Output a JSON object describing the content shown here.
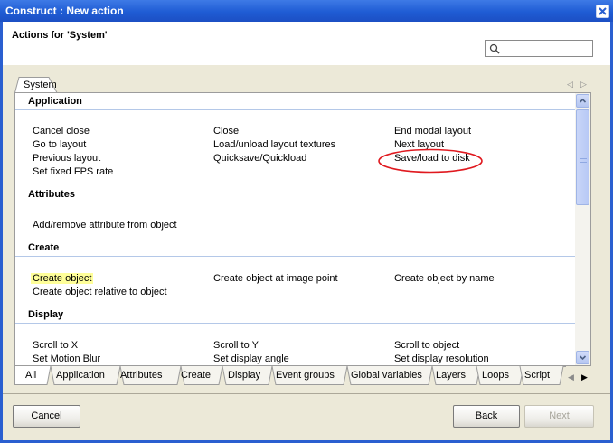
{
  "window": {
    "title": "Construct : New action",
    "header_title": "Actions for 'System'"
  },
  "search": {
    "placeholder": "",
    "value": ""
  },
  "object_tab": "System",
  "sections": [
    {
      "title": "Application",
      "items": [
        "Cancel close",
        "Close",
        "End modal layout",
        "Go to layout",
        "Load/unload layout textures",
        "Next layout",
        "Previous layout",
        "Quicksave/Quickload",
        "Save/load to disk",
        "Set fixed FPS rate"
      ]
    },
    {
      "title": "Attributes",
      "items": [
        "Add/remove attribute from object"
      ]
    },
    {
      "title": "Create",
      "items": [
        "Create object",
        "Create object at image point",
        "Create object by name",
        "Create object relative to object"
      ]
    },
    {
      "title": "Display",
      "items": [
        "Scroll to X",
        "Scroll to Y",
        "Scroll to object",
        "Set Motion Blur",
        "Set display angle",
        "Set display resolution"
      ]
    }
  ],
  "highlighted_item": "Create object",
  "annotated_item": "Save/load to disk",
  "category_tabs": [
    "All",
    "Application",
    "Attributes",
    "Create",
    "Display",
    "Event groups",
    "Global variables",
    "Layers",
    "Loops",
    "Script"
  ],
  "buttons": {
    "cancel": "Cancel",
    "back": "Back",
    "next": "Next"
  },
  "colors": {
    "titlebar": "#245edb",
    "highlight": "#ffff99",
    "annotation": "#e0191f"
  }
}
